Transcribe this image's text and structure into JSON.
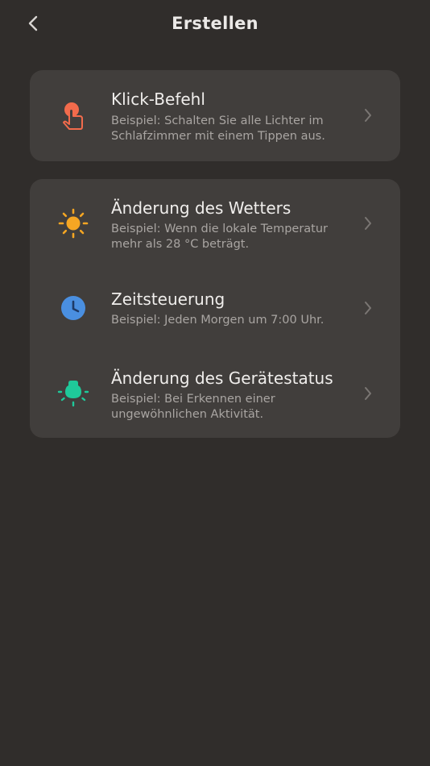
{
  "header": {
    "title": "Erstellen",
    "back_icon": "chevron-left-icon"
  },
  "groups": [
    {
      "items": [
        {
          "title": "Klick-Befehl",
          "description": "Beispiel: Schalten Sie alle Lichter im Schlafzimmer mit einem Tippen aus.",
          "icon": "tap-finger-icon",
          "icon_color": "#f26b4c"
        }
      ]
    },
    {
      "items": [
        {
          "title": "Änderung des Wetters",
          "description": "Beispiel: Wenn die lokale Temperatur mehr als 28 °C beträgt.",
          "icon": "sun-icon",
          "icon_color": "#f5a623"
        },
        {
          "title": "Zeitsteuerung",
          "description": "Beispiel: Jeden Morgen um 7:00 Uhr.",
          "icon": "clock-icon",
          "icon_color": "#4a8fe0"
        },
        {
          "title": "Änderung des Gerätestatus",
          "description": "Beispiel: Bei Erkennen einer ungewöhnlichen Aktivität.",
          "icon": "device-sensor-icon",
          "icon_color": "#1fc99a"
        }
      ]
    }
  ],
  "colors": {
    "background": "#302d2b",
    "card": "#413e3c",
    "title_text": "#f0eeec",
    "desc_text": "#a9a5a2",
    "chevron": "#7a7673"
  }
}
